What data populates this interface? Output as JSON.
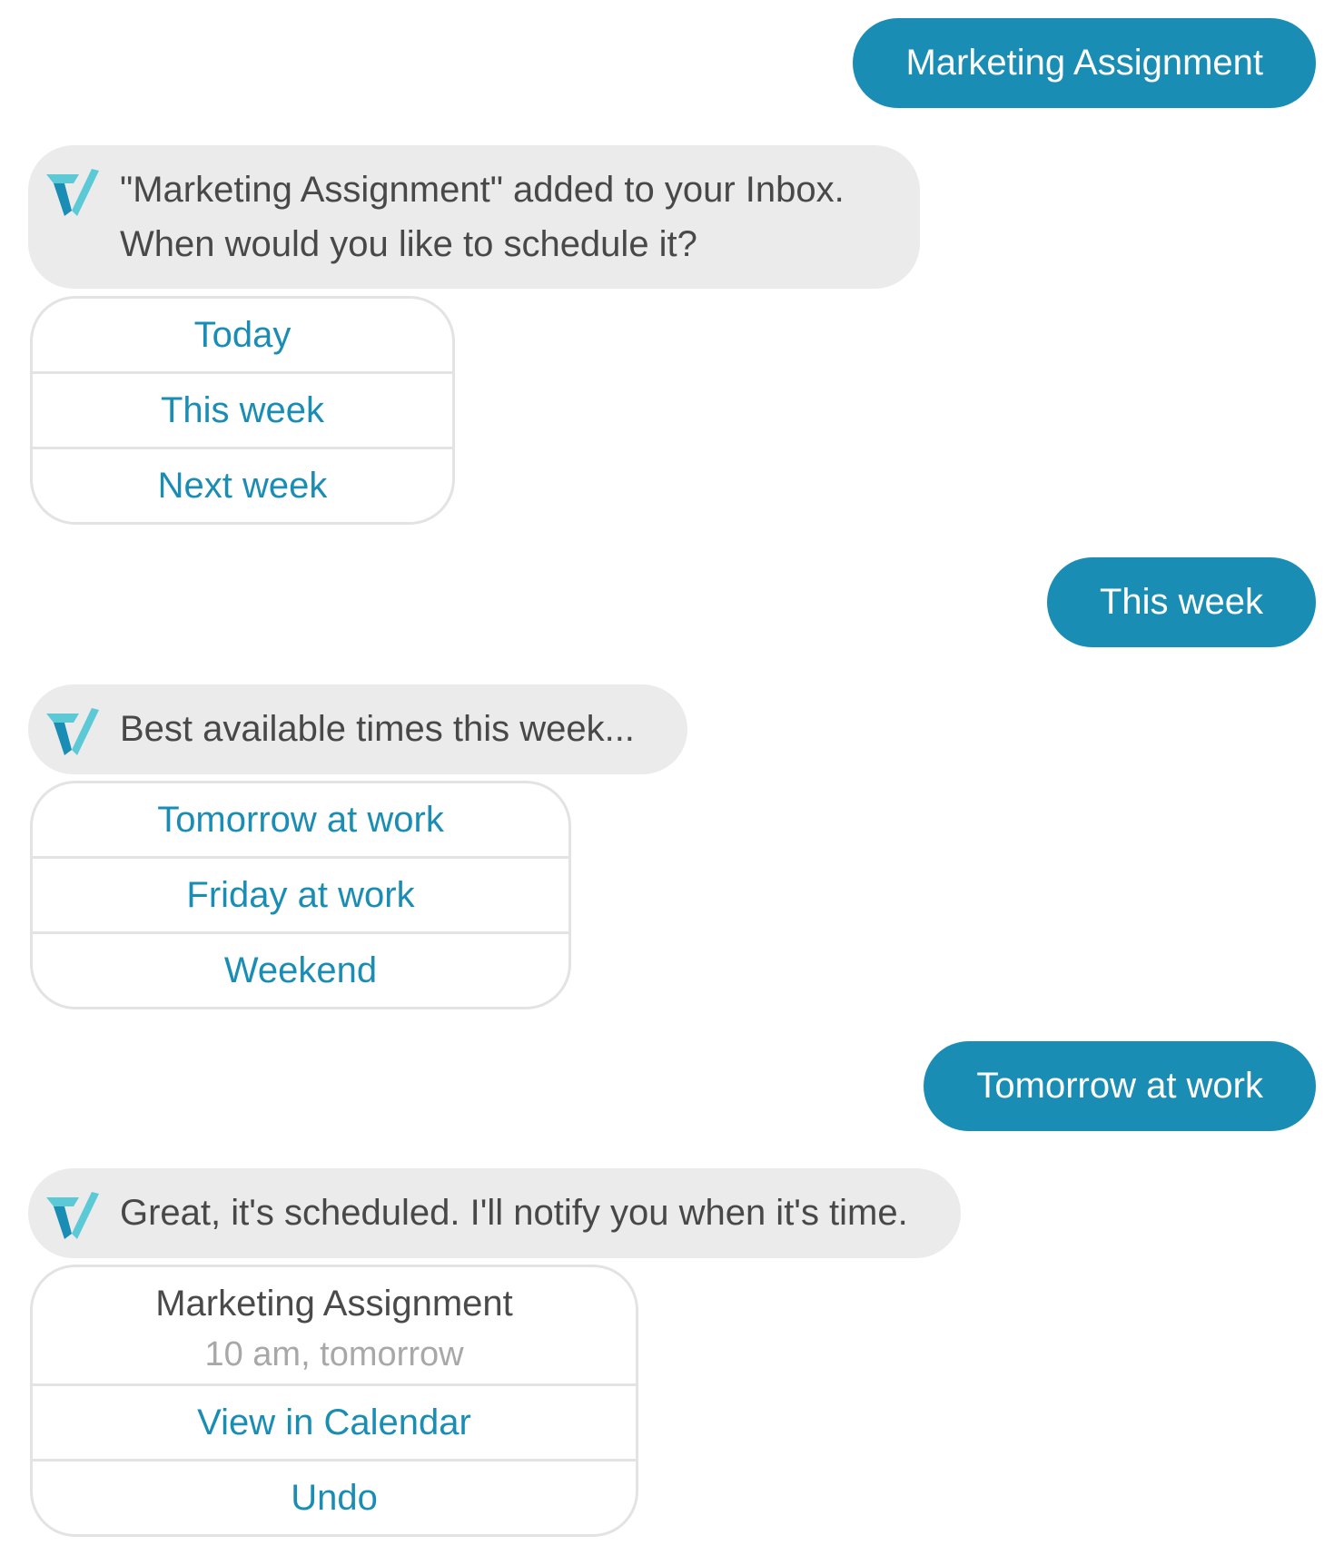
{
  "brand": {
    "accent": "#1a8db5",
    "bot_bubble_bg": "#ebebeb",
    "logo_colors": [
      "#1a8db5",
      "#5cc9d6"
    ]
  },
  "messages": [
    {
      "from": "user",
      "text": "Marketing Assignment"
    },
    {
      "from": "bot",
      "lines": [
        "\"Marketing Assignment\" added to your Inbox.",
        "When would you like to schedule it?"
      ],
      "options": [
        "Today",
        "This week",
        "Next week"
      ]
    },
    {
      "from": "user",
      "text": "This week"
    },
    {
      "from": "bot",
      "lines": [
        "Best available times this week..."
      ],
      "options": [
        "Tomorrow at work",
        "Friday at work",
        "Weekend"
      ]
    },
    {
      "from": "user",
      "text": "Tomorrow at work"
    },
    {
      "from": "bot",
      "lines": [
        "Great, it's scheduled. I'll notify you when it's time."
      ],
      "summary": {
        "title": "Marketing Assignment",
        "subtitle": "10 am, tomorrow"
      },
      "options": [
        "View in Calendar",
        "Undo"
      ]
    }
  ],
  "icons": {
    "bot_avatar": "taskbot-logo-icon"
  }
}
